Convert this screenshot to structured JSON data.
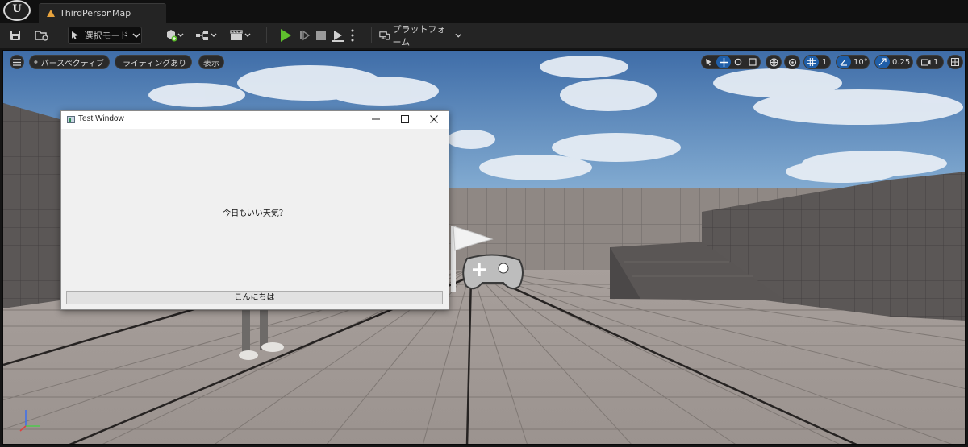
{
  "app": {
    "logo_text": "U",
    "map_tab_label": "ThirdPersonMap"
  },
  "toolbar": {
    "save_icon": "save-icon",
    "browse_icon": "content-browser-icon",
    "mode_label": "選択モード",
    "add_icon": "add-actor-icon",
    "blueprint_icon": "blueprint-icon",
    "cinematics_icon": "clapperboard-icon",
    "play_icon": "play-icon",
    "platforms_label": "プラットフォーム",
    "accent_play": "#5fc02d"
  },
  "viewport": {
    "perspective_label": "パースペクティブ",
    "lighting_label": "ライティングあり",
    "show_label": "表示",
    "grid_snap_value": "1",
    "angle_snap_value": "10°",
    "scale_snap_value": "0.25",
    "camera_speed_value": "1",
    "accent_active": "#1f5ea8"
  },
  "dialog": {
    "title": "Test Window",
    "message": "今日もいい天気？",
    "button_label": "こんにちは"
  }
}
